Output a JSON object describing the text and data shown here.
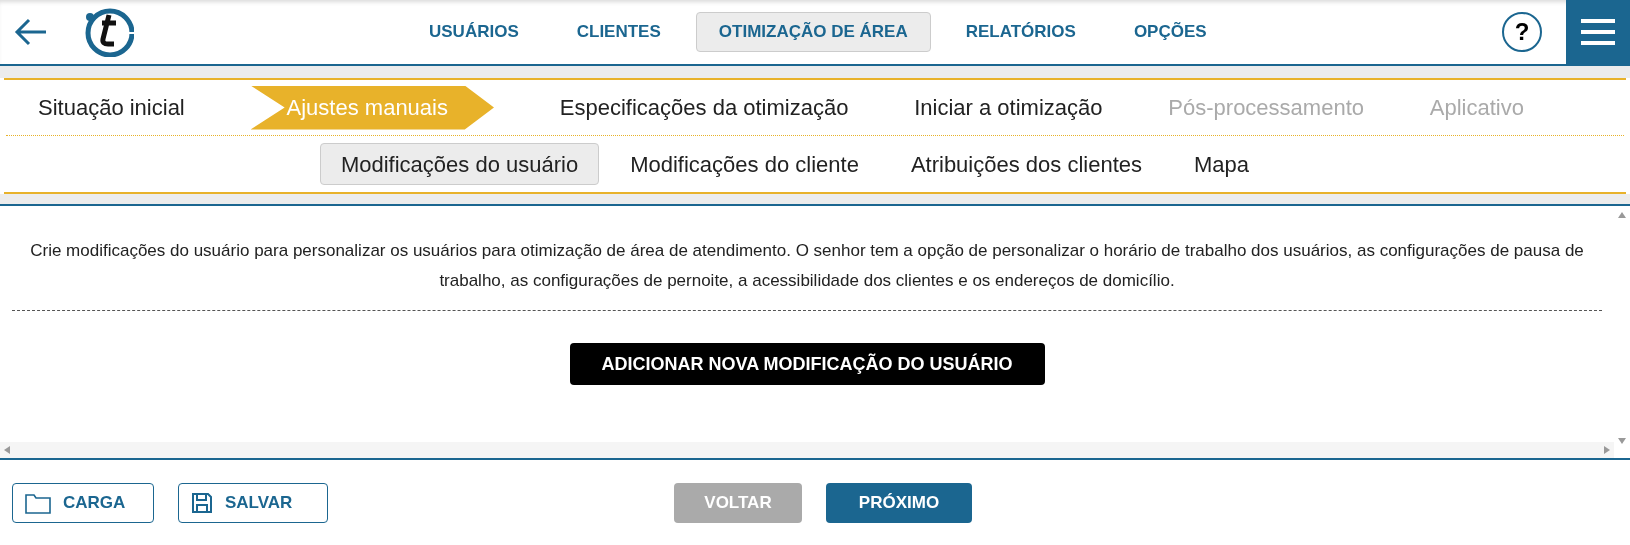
{
  "nav": [
    {
      "label": "USUÁRIOS",
      "selected": false
    },
    {
      "label": "CLIENTES",
      "selected": false
    },
    {
      "label": "OTIMIZAÇÃO DE ÁREA",
      "selected": true
    },
    {
      "label": "RELATÓRIOS",
      "selected": false
    },
    {
      "label": "OPÇÕES",
      "selected": false
    }
  ],
  "help": "?",
  "steps": [
    {
      "label": "Situação inicial",
      "selected": false,
      "disabled": false
    },
    {
      "label": "Ajustes manuais",
      "selected": true,
      "disabled": false
    },
    {
      "label": "Especificações da otimização",
      "selected": false,
      "disabled": false
    },
    {
      "label": "Iniciar a otimização",
      "selected": false,
      "disabled": false
    },
    {
      "label": "Pós-processamento",
      "selected": false,
      "disabled": true
    },
    {
      "label": "Aplicativo",
      "selected": false,
      "disabled": true
    }
  ],
  "subtabs": [
    {
      "label": "Modificações do usuário",
      "selected": true
    },
    {
      "label": "Modificações do cliente",
      "selected": false
    },
    {
      "label": "Atribuições dos clientes",
      "selected": false
    },
    {
      "label": "Mapa",
      "selected": false
    }
  ],
  "description": "Crie modificações do usuário para personalizar os usuários para otimização de área de atendimento. O senhor tem a opção de personalizar o horário de trabalho dos usuários, as configurações de pausa de trabalho, as configurações de pernoite, a acessibilidade dos clientes e os endereços de domicílio.",
  "add_button": "ADICIONAR NOVA MODIFICAÇÃO DO USUÁRIO",
  "footer": {
    "load": "CARGA",
    "save": "SALVAR",
    "back": {
      "label": "VOLTAR",
      "disabled": true
    },
    "next": {
      "label": "PRÓXIMO",
      "disabled": false
    }
  }
}
